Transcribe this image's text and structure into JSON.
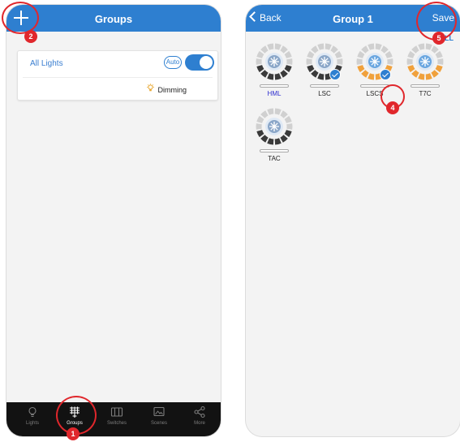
{
  "left_screen": {
    "title": "Groups",
    "add_icon": "plus-icon",
    "group_card": {
      "name": "All Lights",
      "auto_label": "Auto",
      "toggle_on": true,
      "dimming_label": "Dimming",
      "dimming_icon": "lightbulb-icon"
    },
    "tabs": [
      {
        "label": "Lights",
        "icon": "lightbulb-icon",
        "active": false
      },
      {
        "label": "Groups",
        "icon": "groups-icon",
        "active": true
      },
      {
        "label": "Switches",
        "icon": "switches-icon",
        "active": false
      },
      {
        "label": "Scenes",
        "icon": "scenes-icon",
        "active": false
      },
      {
        "label": "More",
        "icon": "share-icon",
        "active": false
      }
    ]
  },
  "right_screen": {
    "back_label": "Back",
    "title": "Group 1",
    "save_label": "Save",
    "all_label": "ALL",
    "lights": [
      {
        "name": "HML",
        "selected": false,
        "accent": "#3a3a3a"
      },
      {
        "name": "LSC",
        "selected": true,
        "accent": "#3a3a3a"
      },
      {
        "name": "LSCS",
        "selected": true,
        "accent": "#f0a13c"
      },
      {
        "name": "T7C",
        "selected": false,
        "accent": "#f0a13c"
      },
      {
        "name": "TAC",
        "selected": false,
        "accent": "#3a3a3a"
      }
    ]
  },
  "annotations": [
    "1",
    "2",
    "4",
    "5"
  ],
  "colors": {
    "primary": "#2e7fd0",
    "annotation": "#e0272c",
    "tabbar": "#121212"
  }
}
